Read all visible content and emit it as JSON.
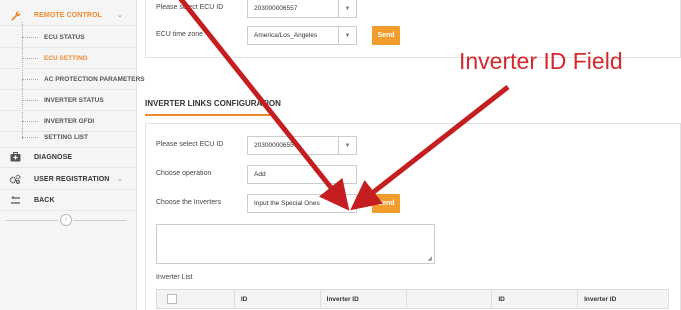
{
  "sidebar": {
    "remote_control": "REMOTE CONTROL",
    "items": [
      {
        "label": "ECU STATUS"
      },
      {
        "label": "ECU SETTING"
      },
      {
        "label": "AC PROTECTION PARAMETERS"
      },
      {
        "label": "INVERTER STATUS"
      },
      {
        "label": "INVERTER GFDI"
      },
      {
        "label": "SETTING LIST"
      }
    ],
    "diagnose": "DIAGNOSE",
    "user_registration": "USER REGISTRATION",
    "back": "BACK",
    "collapse_glyph": "‹",
    "chevron_glyph": "⌄"
  },
  "top_form": {
    "select_ecu_label": "Please select ECU ID",
    "select_ecu_value": "203000006557",
    "time_zone_label": "ECU time zone",
    "time_zone_value": "America/Los_Angeles",
    "send_label": "Send"
  },
  "inverter_links": {
    "title": "INVERTER LINKS CONFIGURATION",
    "select_ecu_label": "Please select ECU ID",
    "select_ecu_value": "203000006557",
    "operation_label": "Choose operation",
    "operation_value": "Add",
    "inverters_label": "Choose the Inverters",
    "inverters_value": "Input the Special Ones",
    "send_label": "Send",
    "list_title": "Inverter List",
    "columns": [
      "",
      "ID",
      "Inverter ID",
      "",
      "ID",
      "Inverter ID"
    ]
  },
  "annotation": {
    "text": "Inverter ID Field",
    "color": "#d4282c"
  },
  "colors": {
    "accent": "#ef8a2f",
    "send_button": "#f39c2e",
    "arrow": "#c41e20"
  },
  "dropdown_glyph": "▼"
}
